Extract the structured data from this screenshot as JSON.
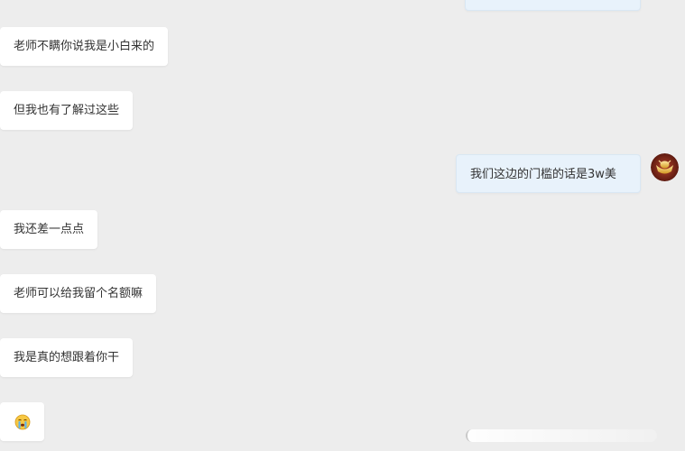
{
  "messages": {
    "m1": "老师不瞒你说我是小白来的",
    "m2": "但我也有了解过这些",
    "m3": "我们这边的门槛的话是3w美",
    "m4": "我还差一点点",
    "m5": "老师可以给我留个名额嘛",
    "m6": "我是真的想跟着你干"
  },
  "icons": {
    "avatar": "gold-ingot-avatar",
    "emoji": "crying-face-emoji"
  },
  "colors": {
    "background": "#ededed",
    "incoming_bubble": "#ffffff",
    "outgoing_bubble": "#e8f2fb",
    "text": "#333333"
  }
}
